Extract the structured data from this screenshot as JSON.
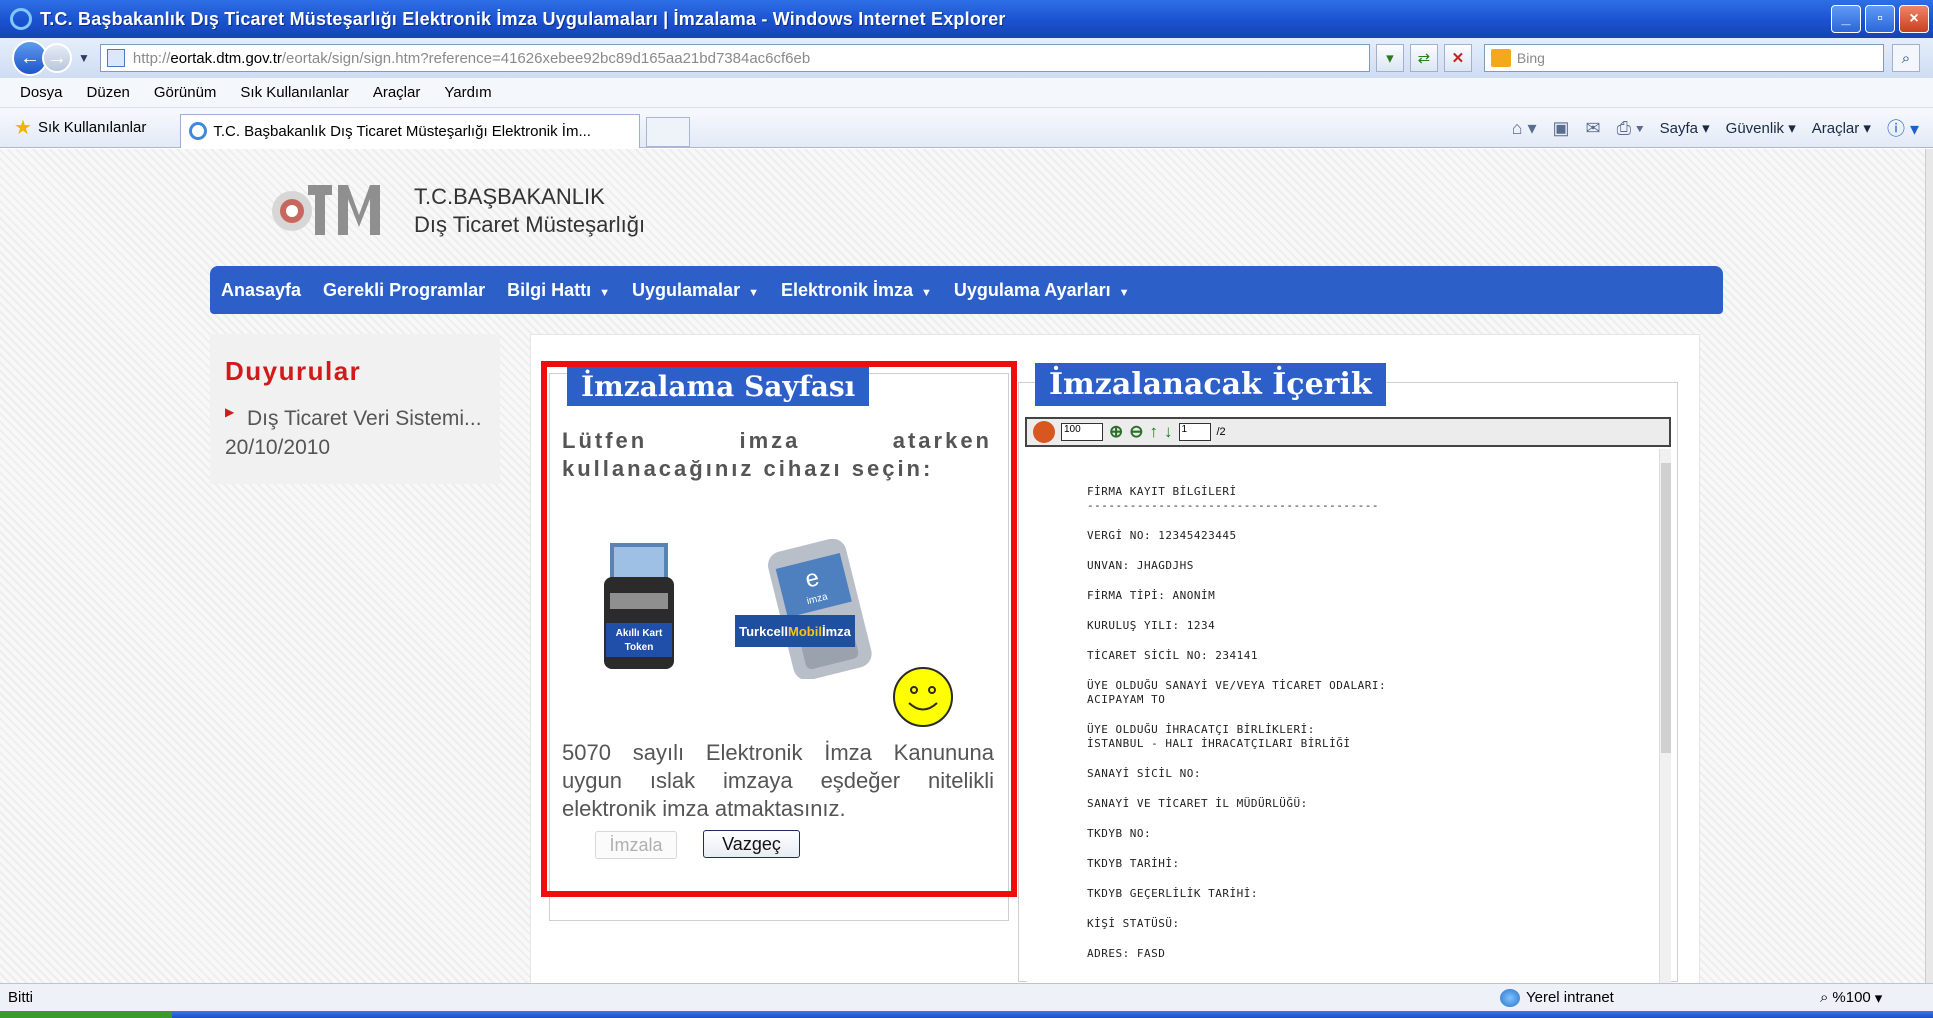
{
  "window": {
    "title": "T.C. Başbakanlık Dış Ticaret Müsteşarlığı Elektronik İmza Uygulamaları | İmzalama - Windows Internet Explorer",
    "minimize": "_",
    "maximize": "▫",
    "close": "×"
  },
  "address": {
    "protocol": "http://",
    "host": "eortak.dtm.gov.tr",
    "path": "/eortak/sign/sign.htm?reference=41626xebee92bc89d165aa21bd7384ac6cf6eb",
    "search_placeholder": "Bing"
  },
  "menu": [
    "Dosya",
    "Düzen",
    "Görünüm",
    "Sık Kullanılanlar",
    "Araçlar",
    "Yardım"
  ],
  "favorites": {
    "label": "Sık Kullanılanlar",
    "tab_title": "T.C. Başbakanlık Dış Ticaret Müsteşarlığı Elektronik İm..."
  },
  "commands": {
    "page": "Sayfa",
    "safety": "Güvenlik",
    "tools": "Araçlar"
  },
  "site": {
    "logo_line1": "T.C.BAŞBAKANLIK",
    "logo_line2": "Dış Ticaret Müsteşarlığı",
    "nav": [
      {
        "label": "Anasayfa",
        "caret": ""
      },
      {
        "label": "Gerekli Programlar",
        "caret": ""
      },
      {
        "label": "Bilgi Hattı",
        "caret": "▼"
      },
      {
        "label": "Uygulamalar",
        "caret": "▼"
      },
      {
        "label": "Elektronik İmza",
        "caret": "▼"
      },
      {
        "label": "Uygulama Ayarları",
        "caret": "▼"
      }
    ]
  },
  "announcements": {
    "title": "Duyurular",
    "item": "Dış Ticaret Veri Sistemi... 20/10/2010"
  },
  "sign_panel": {
    "title": "İmzalama Sayfası",
    "prompt": "Lütfen imza atarken kullanacağınız cihazı seçin:",
    "token_label_1": "Akıllı Kart",
    "token_label_2": "Token",
    "mobile_label_prefix": "Turkcell",
    "mobile_label_mid": "Mobil",
    "mobile_label_suffix": "İmza",
    "mobile_screen_1": "e",
    "mobile_screen_2": "imza",
    "law_text": "5070 sayılı Elektronik İmza Kanununa uygun ıslak imzaya eşdeğer nitelikli elektronik imza atmaktasınız.",
    "sign_button": "İmzala",
    "cancel_button": "Vazgeç"
  },
  "content_panel": {
    "title": "İmzalanacak İçerik",
    "zoom": "100",
    "page": "1",
    "page_total": "/2",
    "doc_lines": [
      "FİRMA KAYIT BİLGİLERİ",
      "-----------------------------------------",
      "VERGİ NO: 12345423445",
      "UNVAN: JHAGDJHS",
      "FİRMA TİPİ: ANONİM",
      "KURULUŞ YILI: 1234",
      "TİCARET SİCİL NO: 234141",
      "ÜYE OLDUĞU SANAYİ VE/VEYA TİCARET ODALARI:",
      "ACIPAYAM TO",
      "ÜYE OLDUĞU İHRACATÇI BİRLİKLERİ:",
      "İSTANBUL - HALI İHRACATÇILARI BİRLİĞİ",
      "SANAYİ SİCİL NO:",
      "SANAYİ VE TİCARET İL MÜDÜRLÜĞÜ:",
      "TKDYB NO:",
      "TKDYB TARİHİ:",
      "TKDYB GEÇERLİLİK TARİHİ:",
      "KİŞİ STATÜSÜ:",
      "ADRES: FASD"
    ]
  },
  "status": {
    "text": "Bitti",
    "zone": "Yerel intranet",
    "zoom": "%100"
  }
}
